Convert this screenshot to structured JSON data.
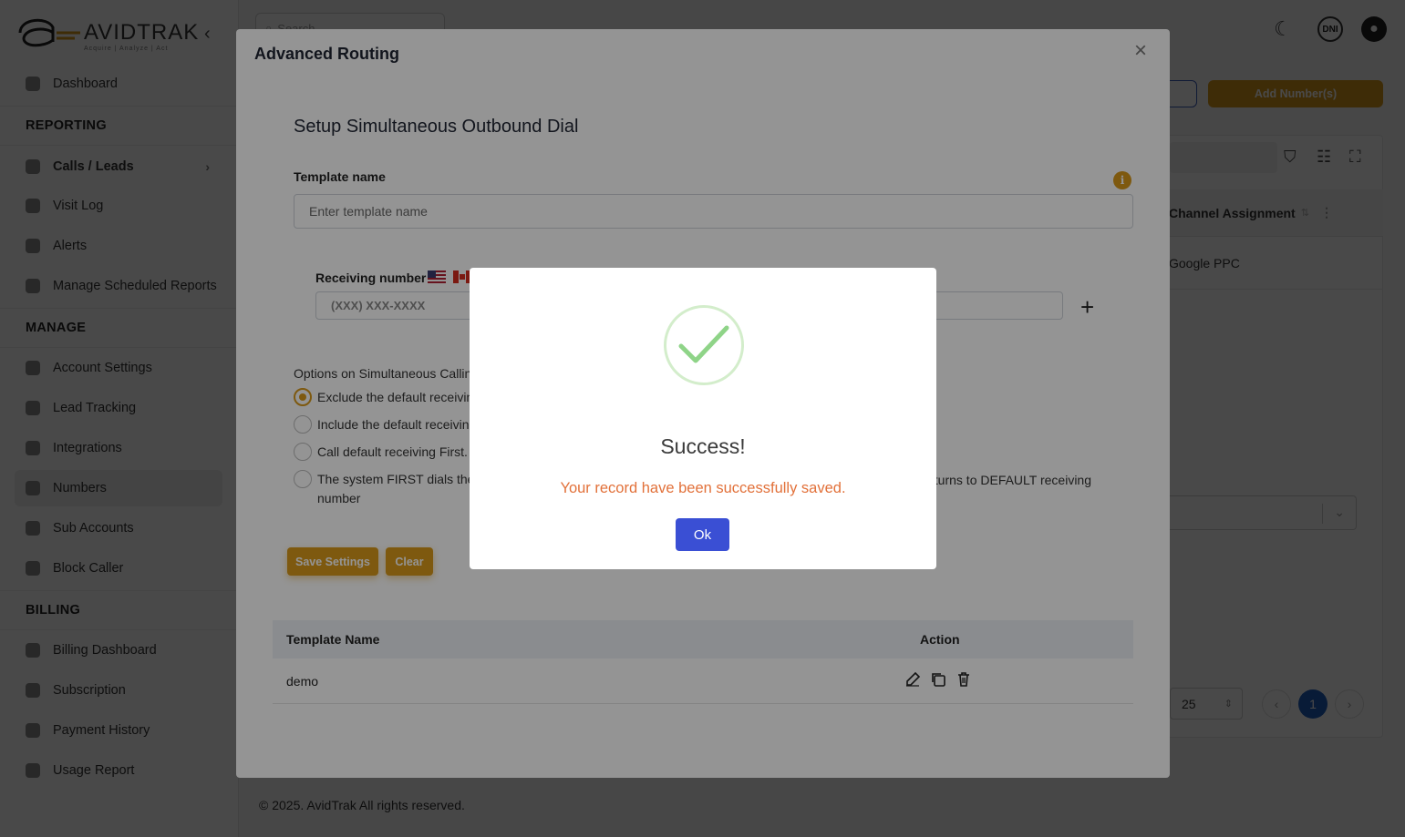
{
  "app": {
    "logo_text": "AVIDTRAK",
    "logo_tagline": "Acquire | Analyze | Act",
    "search_placeholder": "Search",
    "dni_label": "DNI",
    "footer": "© 2025. AvidTrak All rights reserved."
  },
  "sidebar": {
    "dashboard": "Dashboard",
    "reporting": "REPORTING",
    "calls_leads": "Calls / Leads",
    "visit_log": "Visit Log",
    "alerts": "Alerts",
    "scheduled_reports": "Manage Scheduled Reports",
    "manage": "MANAGE",
    "account_settings": "Account Settings",
    "lead_tracking": "Lead Tracking",
    "integrations": "Integrations",
    "numbers": "Numbers",
    "sub_accounts": "Sub Accounts",
    "block_caller": "Block Caller",
    "billing": "BILLING",
    "billing_dashboard": "Billing Dashboard",
    "subscription": "Subscription",
    "payment_history": "Payment History",
    "usage_report": "Usage Report"
  },
  "background": {
    "add_numbers": "Add Number(s)",
    "column_header": "Channel Assignment",
    "row_value": "Google PPC",
    "page_size": "25",
    "current_page": "1"
  },
  "modal": {
    "title": "Advanced Routing",
    "heading": "Setup Simultaneous Outbound Dial",
    "template_label": "Template name",
    "template_placeholder": "Enter template name",
    "receiving_label": "Receiving number",
    "receiving_placeholder": "(XXX) XXX-XXXX",
    "options_heading": "Options on Simultaneous Callin",
    "options": [
      "Exclude the default receivin",
      "Include the default receivin",
      "Call default receiving First.",
      "The system FIRST dials the"
    ],
    "option4_tail": "eturns to DEFAULT receiving",
    "option4_line2": "number",
    "save_button": "Save Settings",
    "clear_button": "Clear",
    "table": {
      "col_name": "Template Name",
      "col_action": "Action",
      "rows": [
        {
          "name": "demo"
        }
      ]
    }
  },
  "dialog": {
    "title": "Success!",
    "message": "Your record have been successfully saved.",
    "ok_button": "Ok"
  },
  "colors": {
    "accent": "#d99a1a",
    "primary_blue": "#3a4fd4",
    "success_green": "#8fd488",
    "message_orange": "#e2713a"
  }
}
